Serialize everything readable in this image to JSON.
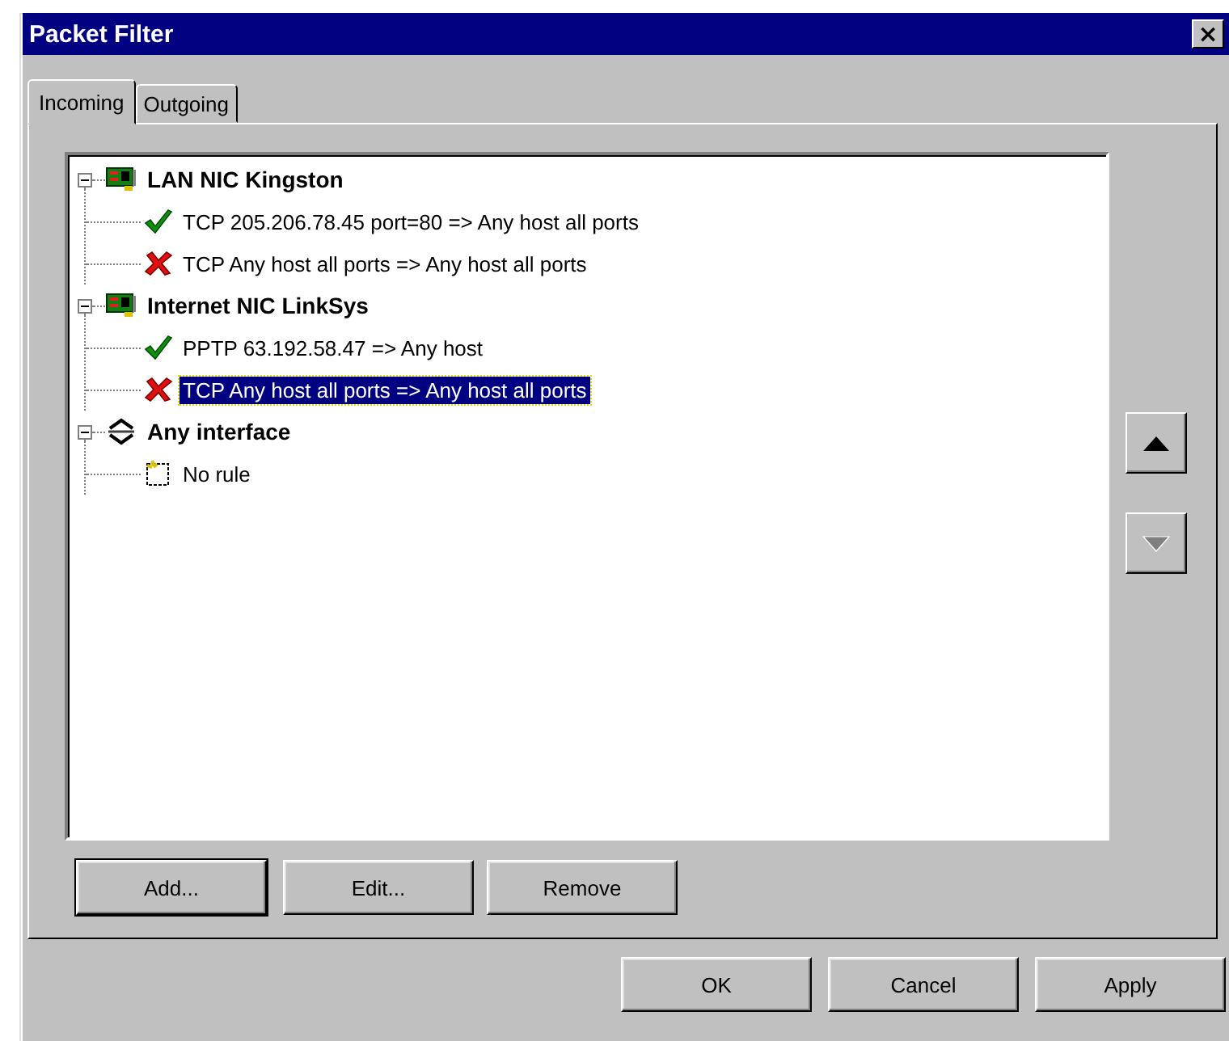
{
  "window": {
    "title": "Packet Filter",
    "close": "×"
  },
  "tabs": [
    {
      "label": "Incoming",
      "selected": true
    },
    {
      "label": "Outgoing",
      "selected": false
    }
  ],
  "tree": [
    {
      "kind": "nic",
      "label": "LAN NIC Kingston",
      "expanded": true,
      "children": [
        {
          "kind": "allow",
          "label": "TCP 205.206.78.45 port=80 => Any host all ports",
          "selected": false
        },
        {
          "kind": "deny",
          "label": "TCP Any host all ports => Any host all ports",
          "selected": false
        }
      ]
    },
    {
      "kind": "nic",
      "label": "Internet NIC LinkSys",
      "expanded": true,
      "children": [
        {
          "kind": "allow",
          "label": "PPTP 63.192.58.47 => Any host",
          "selected": false
        },
        {
          "kind": "deny",
          "label": "TCP Any host all ports => Any host all ports",
          "selected": true
        }
      ]
    },
    {
      "kind": "any",
      "label": "Any interface",
      "expanded": true,
      "children": [
        {
          "kind": "empty",
          "label": "No rule",
          "selected": false
        }
      ]
    }
  ],
  "move_buttons": [
    {
      "kind": "up",
      "disabled": false
    },
    {
      "kind": "down",
      "disabled": true
    }
  ],
  "rule_buttons": [
    {
      "label": "Add...",
      "default": true
    },
    {
      "label": "Edit...",
      "default": false
    },
    {
      "label": "Remove",
      "default": false
    }
  ],
  "dialog_buttons": [
    {
      "label": "OK",
      "default": false
    },
    {
      "label": "Cancel",
      "default": false
    },
    {
      "label": "Apply",
      "default": false
    }
  ]
}
